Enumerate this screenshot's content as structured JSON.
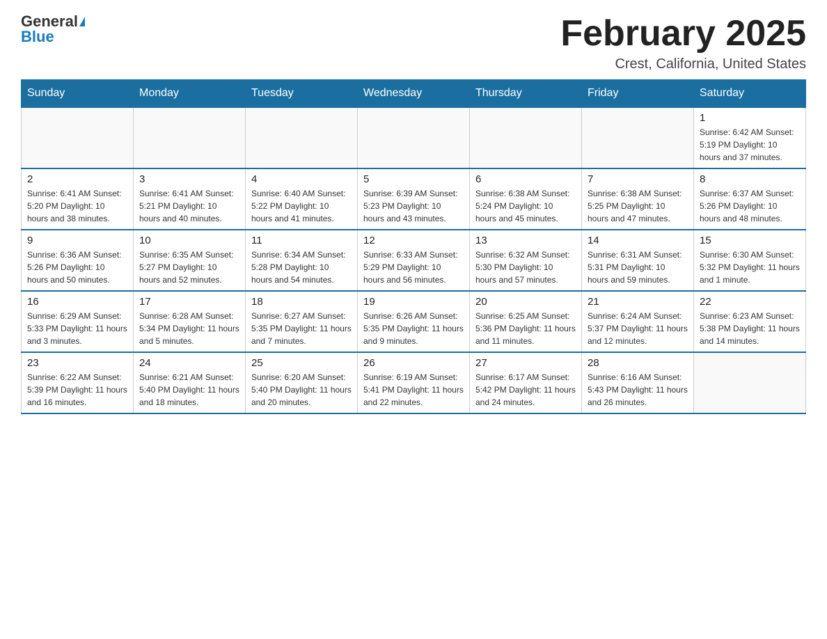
{
  "header": {
    "logo_general": "General",
    "logo_blue": "Blue",
    "month_title": "February 2025",
    "location": "Crest, California, United States"
  },
  "days_of_week": [
    "Sunday",
    "Monday",
    "Tuesday",
    "Wednesday",
    "Thursday",
    "Friday",
    "Saturday"
  ],
  "weeks": [
    [
      {
        "day": "",
        "info": ""
      },
      {
        "day": "",
        "info": ""
      },
      {
        "day": "",
        "info": ""
      },
      {
        "day": "",
        "info": ""
      },
      {
        "day": "",
        "info": ""
      },
      {
        "day": "",
        "info": ""
      },
      {
        "day": "1",
        "info": "Sunrise: 6:42 AM\nSunset: 5:19 PM\nDaylight: 10 hours and 37 minutes."
      }
    ],
    [
      {
        "day": "2",
        "info": "Sunrise: 6:41 AM\nSunset: 5:20 PM\nDaylight: 10 hours and 38 minutes."
      },
      {
        "day": "3",
        "info": "Sunrise: 6:41 AM\nSunset: 5:21 PM\nDaylight: 10 hours and 40 minutes."
      },
      {
        "day": "4",
        "info": "Sunrise: 6:40 AM\nSunset: 5:22 PM\nDaylight: 10 hours and 41 minutes."
      },
      {
        "day": "5",
        "info": "Sunrise: 6:39 AM\nSunset: 5:23 PM\nDaylight: 10 hours and 43 minutes."
      },
      {
        "day": "6",
        "info": "Sunrise: 6:38 AM\nSunset: 5:24 PM\nDaylight: 10 hours and 45 minutes."
      },
      {
        "day": "7",
        "info": "Sunrise: 6:38 AM\nSunset: 5:25 PM\nDaylight: 10 hours and 47 minutes."
      },
      {
        "day": "8",
        "info": "Sunrise: 6:37 AM\nSunset: 5:26 PM\nDaylight: 10 hours and 48 minutes."
      }
    ],
    [
      {
        "day": "9",
        "info": "Sunrise: 6:36 AM\nSunset: 5:26 PM\nDaylight: 10 hours and 50 minutes."
      },
      {
        "day": "10",
        "info": "Sunrise: 6:35 AM\nSunset: 5:27 PM\nDaylight: 10 hours and 52 minutes."
      },
      {
        "day": "11",
        "info": "Sunrise: 6:34 AM\nSunset: 5:28 PM\nDaylight: 10 hours and 54 minutes."
      },
      {
        "day": "12",
        "info": "Sunrise: 6:33 AM\nSunset: 5:29 PM\nDaylight: 10 hours and 56 minutes."
      },
      {
        "day": "13",
        "info": "Sunrise: 6:32 AM\nSunset: 5:30 PM\nDaylight: 10 hours and 57 minutes."
      },
      {
        "day": "14",
        "info": "Sunrise: 6:31 AM\nSunset: 5:31 PM\nDaylight: 10 hours and 59 minutes."
      },
      {
        "day": "15",
        "info": "Sunrise: 6:30 AM\nSunset: 5:32 PM\nDaylight: 11 hours and 1 minute."
      }
    ],
    [
      {
        "day": "16",
        "info": "Sunrise: 6:29 AM\nSunset: 5:33 PM\nDaylight: 11 hours and 3 minutes."
      },
      {
        "day": "17",
        "info": "Sunrise: 6:28 AM\nSunset: 5:34 PM\nDaylight: 11 hours and 5 minutes."
      },
      {
        "day": "18",
        "info": "Sunrise: 6:27 AM\nSunset: 5:35 PM\nDaylight: 11 hours and 7 minutes."
      },
      {
        "day": "19",
        "info": "Sunrise: 6:26 AM\nSunset: 5:35 PM\nDaylight: 11 hours and 9 minutes."
      },
      {
        "day": "20",
        "info": "Sunrise: 6:25 AM\nSunset: 5:36 PM\nDaylight: 11 hours and 11 minutes."
      },
      {
        "day": "21",
        "info": "Sunrise: 6:24 AM\nSunset: 5:37 PM\nDaylight: 11 hours and 12 minutes."
      },
      {
        "day": "22",
        "info": "Sunrise: 6:23 AM\nSunset: 5:38 PM\nDaylight: 11 hours and 14 minutes."
      }
    ],
    [
      {
        "day": "23",
        "info": "Sunrise: 6:22 AM\nSunset: 5:39 PM\nDaylight: 11 hours and 16 minutes."
      },
      {
        "day": "24",
        "info": "Sunrise: 6:21 AM\nSunset: 5:40 PM\nDaylight: 11 hours and 18 minutes."
      },
      {
        "day": "25",
        "info": "Sunrise: 6:20 AM\nSunset: 5:40 PM\nDaylight: 11 hours and 20 minutes."
      },
      {
        "day": "26",
        "info": "Sunrise: 6:19 AM\nSunset: 5:41 PM\nDaylight: 11 hours and 22 minutes."
      },
      {
        "day": "27",
        "info": "Sunrise: 6:17 AM\nSunset: 5:42 PM\nDaylight: 11 hours and 24 minutes."
      },
      {
        "day": "28",
        "info": "Sunrise: 6:16 AM\nSunset: 5:43 PM\nDaylight: 11 hours and 26 minutes."
      },
      {
        "day": "",
        "info": ""
      }
    ]
  ]
}
